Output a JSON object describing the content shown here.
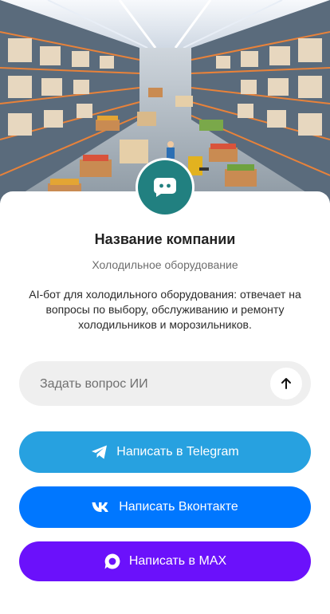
{
  "company": {
    "name": "Название компании",
    "subtitle": "Холодильное оборудование",
    "description": "AI-бот для холодильного оборудования: отвечает на вопросы по выбору, обслуживанию и ремонту холодильников и морозильников."
  },
  "ask": {
    "placeholder": "Задать вопрос ИИ"
  },
  "buttons": {
    "telegram": {
      "label": "Написать в Telegram",
      "icon": "telegram-icon",
      "color": "#27a1e0"
    },
    "vk": {
      "label": "Написать Вконтакте",
      "icon": "vk-icon",
      "color": "#0077ff"
    },
    "max": {
      "label": "Написать в MAX",
      "icon": "max-icon",
      "color": "#6b11fb"
    }
  },
  "colors": {
    "avatar": "#218080",
    "ask_background": "#efefef"
  }
}
